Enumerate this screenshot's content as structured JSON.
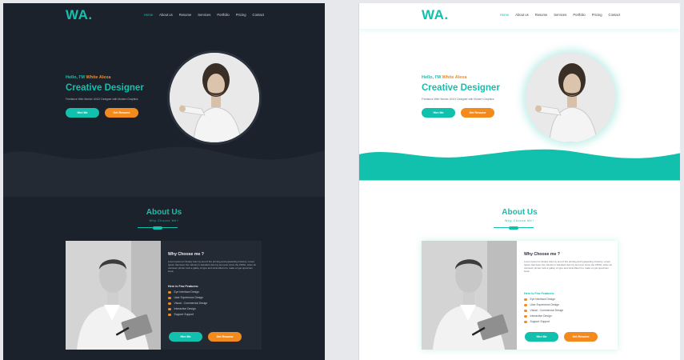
{
  "brand": {
    "logo": "WA",
    "logo_dot": "."
  },
  "nav": {
    "items": [
      "Home",
      "About us",
      "Resume",
      "Services",
      "Portfolio",
      "Pricing",
      "Contact"
    ]
  },
  "hero": {
    "hello_prefix": "Hello, I'M",
    "name": "White Alexa",
    "role": "Creative Designer",
    "tagline": "Freelance Web Worker UI/UX Designer with Modern Graphics",
    "hire_label": "Hire Me",
    "resume_label": "Get Resume"
  },
  "about": {
    "title": "About Us",
    "subtitle": "Why Choose Me?",
    "heading": "Why Choose me ?",
    "paragraph": "Lorem Ipsum is Simply dummy text of the printing and typesetting industry. Lorem Ipsum has been the industry's standard dummy text ever since the 1500s, when an unknown printer took a galley of type and scrambled it to make a type specimen book.",
    "features_title": "Here Is Few Features:",
    "features": [
      "Eye Interface Design",
      "User Experience Design",
      "Visual - Commercial Design",
      "Interactive Design",
      "Support Support"
    ],
    "hire_label": "Hire Me",
    "resume_label": "Get Resume"
  },
  "colors": {
    "accent": "#11c1ad",
    "orange": "#f38a1d",
    "dark_bg": "#1c222b",
    "wave_dark": "#232a34"
  },
  "icons": {
    "avatar": "designer-portrait",
    "about_photo": "businessman-with-tablet"
  }
}
